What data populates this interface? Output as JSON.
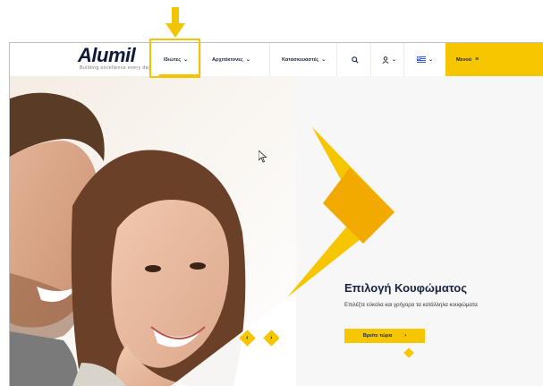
{
  "annotation": {
    "arrow_color": "#f2c500"
  },
  "brand": {
    "logo_text": "Alumil",
    "tagline": "Building excellence every day"
  },
  "nav": {
    "items": [
      {
        "label": "Ιδιώτες"
      },
      {
        "label": "Αρχιτέκτονες"
      },
      {
        "label": "Κατασκευαστές"
      }
    ],
    "search_icon": "search-icon",
    "user_icon": "user-icon",
    "language_icon": "greek-flag-icon",
    "menu_label": "Μενού"
  },
  "hero": {
    "title": "Επιλογή Κουφώματος",
    "subtitle": "Επιλέξτε εύκολα και γρήγορα τα κατάλληλα κουφώματα",
    "cta_label": "Βρείτε τώρα",
    "cta_arrow": "›",
    "prev_label": "‹",
    "next_label": "›"
  },
  "colors": {
    "accent": "#f6c600",
    "accent_dark": "#f2a900",
    "text_dark": "#1a2340"
  }
}
